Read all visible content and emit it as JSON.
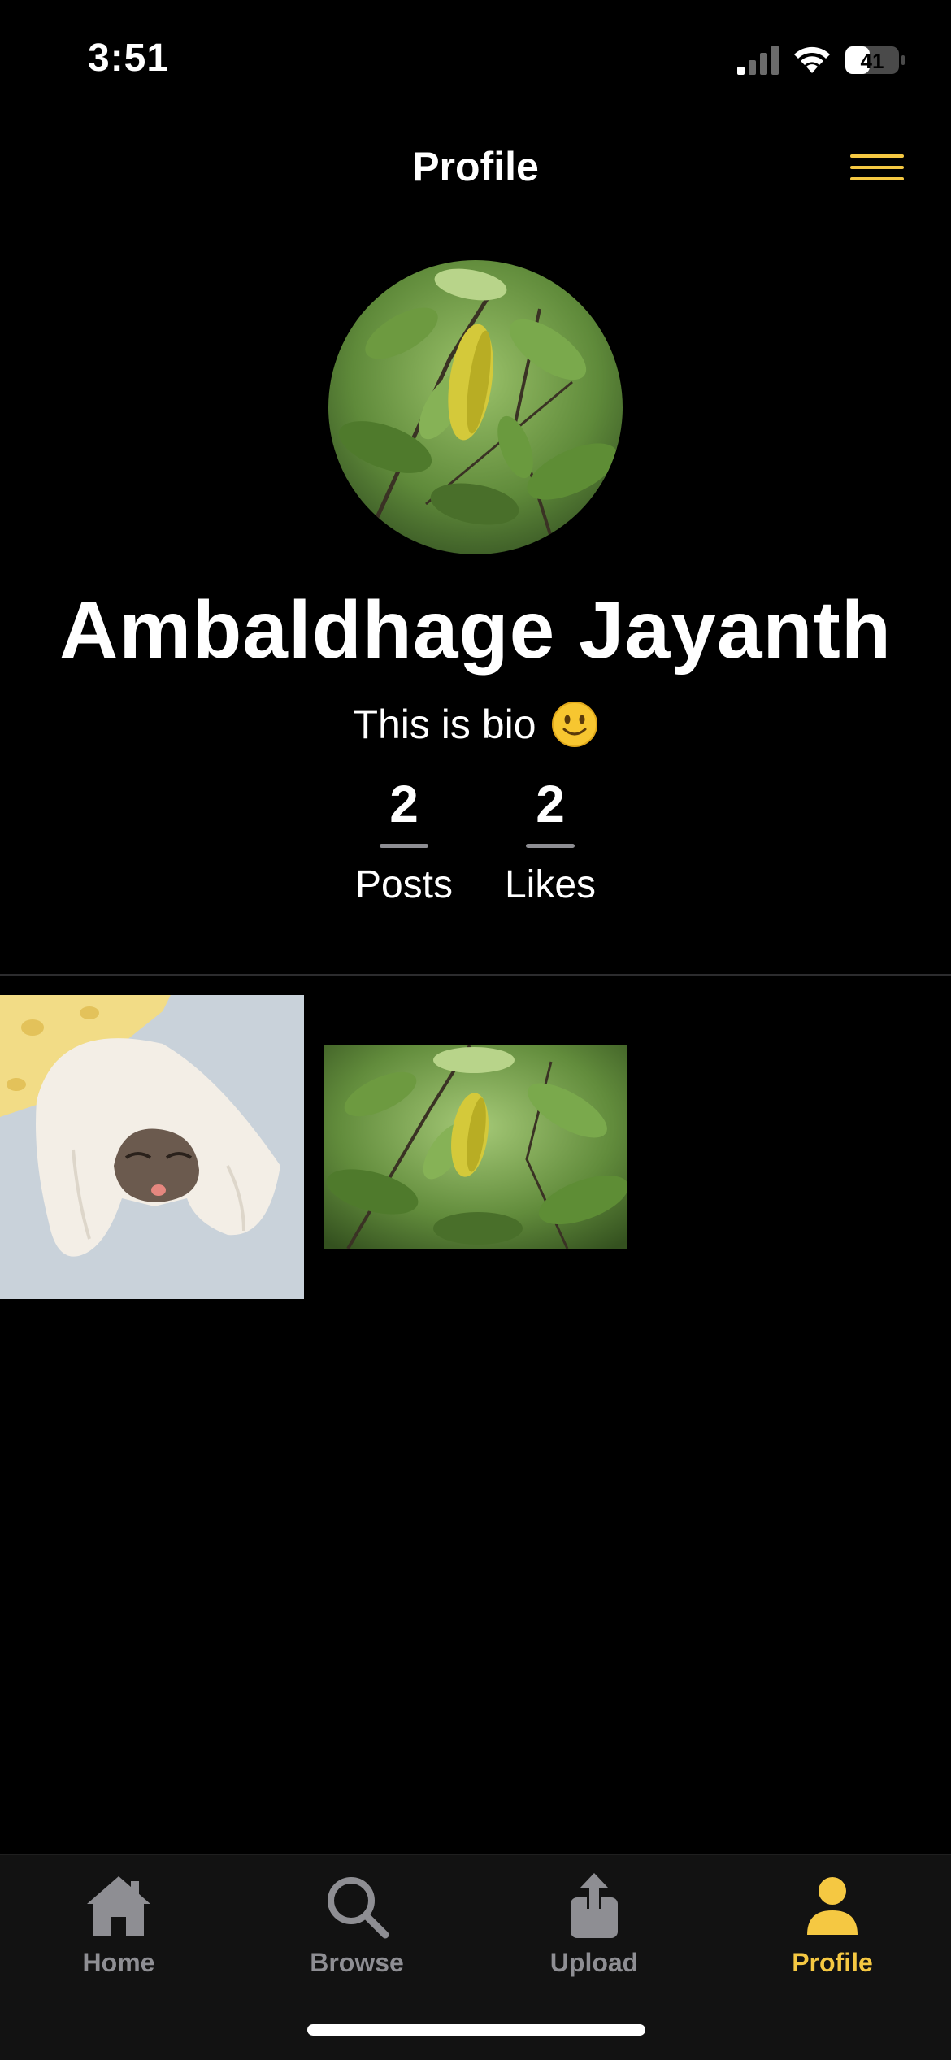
{
  "status_bar": {
    "time": "3:51",
    "battery": "41"
  },
  "header": {
    "title": "Profile",
    "menu_icon": "hamburger-menu-icon"
  },
  "profile": {
    "avatar_image": "leafy-branch-photo",
    "name": "Ambaldhage Jayanth",
    "bio": "This is bio",
    "bio_emoji": "🙂",
    "stats": [
      {
        "value": "2",
        "label": "Posts"
      },
      {
        "value": "2",
        "label": "Likes"
      }
    ]
  },
  "posts": [
    {
      "image": "cat-under-towel-photo"
    },
    {
      "image": "leafy-branch-photo"
    }
  ],
  "tab_bar": {
    "tabs": [
      {
        "label": "Home",
        "icon": "home-icon",
        "active": false
      },
      {
        "label": "Browse",
        "icon": "search-icon",
        "active": false
      },
      {
        "label": "Upload",
        "icon": "upload-icon",
        "active": false
      },
      {
        "label": "Profile",
        "icon": "person-icon",
        "active": true
      }
    ]
  },
  "colors": {
    "accent": "#F5C842",
    "inactive": "#8E8E93",
    "background": "#000000",
    "tab_bar_bg": "#121212"
  }
}
